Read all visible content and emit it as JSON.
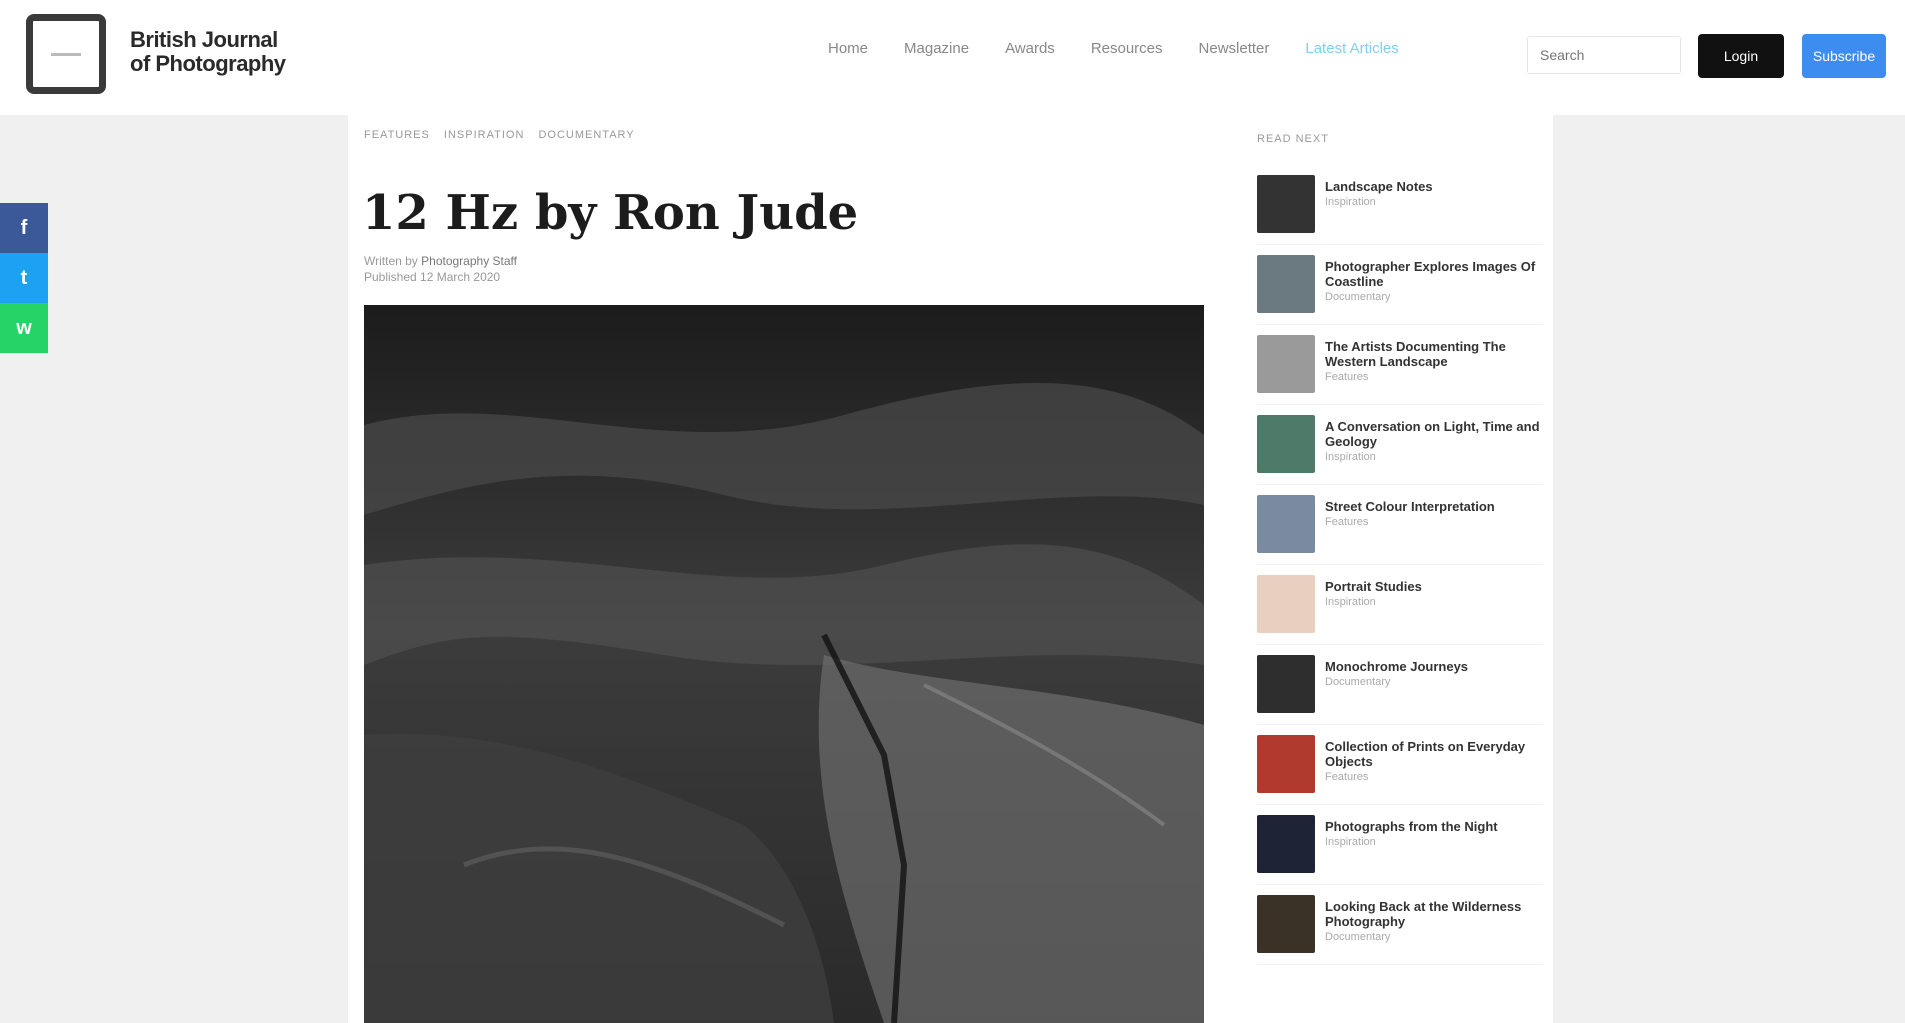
{
  "brand": {
    "line1": "British Journal",
    "line2": "of Photography"
  },
  "nav": {
    "items": [
      "Home",
      "Magazine",
      "Awards",
      "Resources",
      "Newsletter",
      "Latest Articles"
    ],
    "search_placeholder": "Search",
    "dark_button": "Login",
    "blue_button": "Subscribe"
  },
  "colors": {
    "facebook": "#3b5998",
    "twitter": "#1da1f2",
    "whatsapp": "#25d366",
    "subscribe": "#3d8df0",
    "highlight": "#7fd0f0"
  },
  "share": {
    "facebook_icon": "f",
    "twitter_icon": "t",
    "whatsapp_icon": "w"
  },
  "article": {
    "breadcrumb": [
      "Features",
      "Inspiration",
      "Documentary"
    ],
    "title": "12 Hz by Ron Jude",
    "byline": "Written by",
    "author": "Photography Staff",
    "date": "Published 12 March 2020"
  },
  "sidebar": {
    "title": "Read next",
    "items": [
      {
        "headline": "Landscape Notes",
        "meta": "Inspiration"
      },
      {
        "headline": "Photographer Explores Images Of Coastline",
        "meta": "Documentary"
      },
      {
        "headline": "The Artists Documenting The Western Landscape",
        "meta": "Features"
      },
      {
        "headline": "A Conversation on Light, Time and Geology",
        "meta": "Inspiration"
      },
      {
        "headline": "Street Colour Interpretation",
        "meta": "Features"
      },
      {
        "headline": "Portrait Studies",
        "meta": "Inspiration"
      },
      {
        "headline": "Monochrome Journeys",
        "meta": "Documentary"
      },
      {
        "headline": "Collection of Prints on Everyday Objects",
        "meta": "Features"
      },
      {
        "headline": "Photographs from the Night",
        "meta": "Inspiration"
      },
      {
        "headline": "Looking Back at the Wilderness Photography",
        "meta": "Documentary"
      }
    ]
  }
}
